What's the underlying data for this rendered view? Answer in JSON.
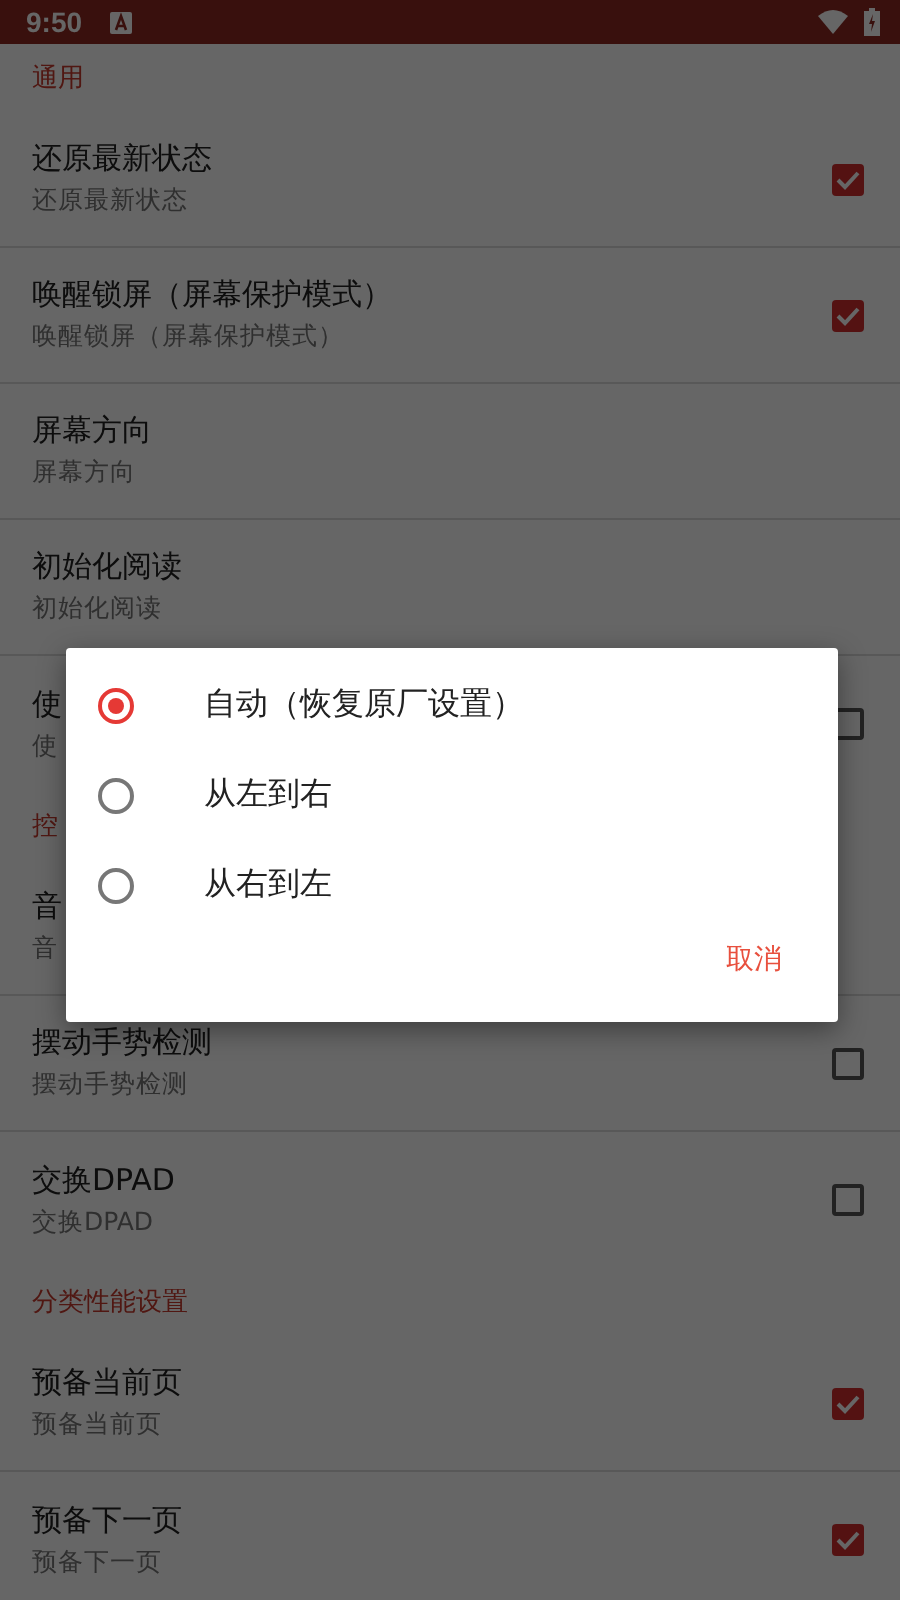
{
  "status_bar": {
    "time": "9:50"
  },
  "sections": [
    {
      "header": "通用",
      "items": [
        {
          "title": "还原最新状态",
          "subtitle": "还原最新状态",
          "kind": "checkbox",
          "checked": true
        },
        {
          "title": "唤醒锁屏（屏幕保护模式）",
          "subtitle": "唤醒锁屏（屏幕保护模式）",
          "kind": "checkbox",
          "checked": true
        },
        {
          "title": "屏幕方向",
          "subtitle": "屏幕方向",
          "kind": "text"
        },
        {
          "title": "初始化阅读",
          "subtitle": "初始化阅读",
          "kind": "text"
        },
        {
          "title": "使",
          "subtitle": "使",
          "kind": "checkbox",
          "checked": false
        }
      ]
    },
    {
      "header": "控",
      "items": [
        {
          "title": "音",
          "subtitle": "音",
          "kind": "text"
        },
        {
          "title": "摆动手势检测",
          "subtitle": "摆动手势检测",
          "kind": "checkbox",
          "checked": false
        },
        {
          "title": "交换DPAD",
          "subtitle": "交换DPAD",
          "kind": "checkbox",
          "checked": false
        }
      ]
    },
    {
      "header": "分类性能设置",
      "items": [
        {
          "title": "预备当前页",
          "subtitle": "预备当前页",
          "kind": "checkbox",
          "checked": true
        },
        {
          "title": "预备下一页",
          "subtitle": "预备下一页",
          "kind": "checkbox",
          "checked": true
        }
      ]
    }
  ],
  "dialog": {
    "options": [
      {
        "label": "自动（恢复原厂设置）",
        "selected": true
      },
      {
        "label": "从左到右",
        "selected": false
      },
      {
        "label": "从右到左",
        "selected": false
      }
    ],
    "cancel": "取消"
  }
}
